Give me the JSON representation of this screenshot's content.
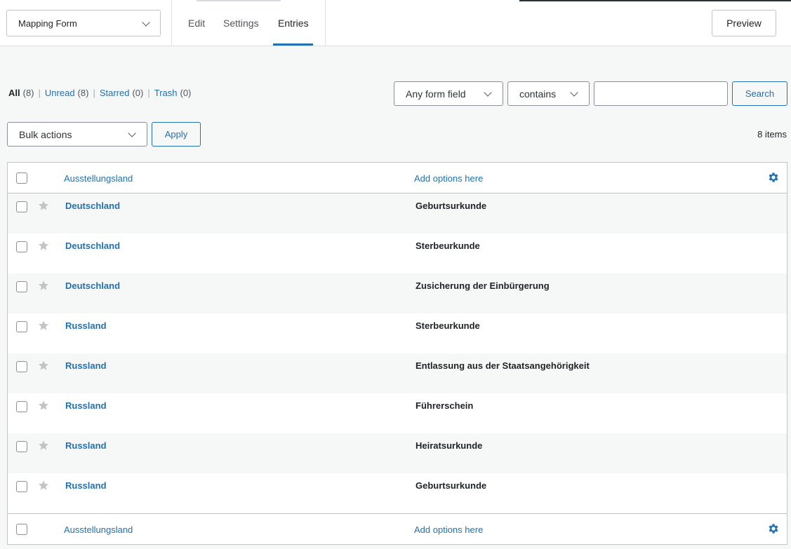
{
  "header": {
    "form_selector": "Mapping Form",
    "tabs": [
      {
        "label": "Edit"
      },
      {
        "label": "Settings"
      },
      {
        "label": "Entries"
      }
    ],
    "preview_label": "Preview"
  },
  "filters": {
    "views": [
      {
        "label": "All",
        "count": "(8)"
      },
      {
        "label": "Unread",
        "count": "(8)"
      },
      {
        "label": "Starred",
        "count": "(0)"
      },
      {
        "label": "Trash",
        "count": "(0)"
      }
    ],
    "field_select": "Any form field",
    "operator_select": "contains",
    "search_value": "",
    "search_label": "Search",
    "bulk_actions": "Bulk actions",
    "apply_label": "Apply",
    "items_count": "8 items"
  },
  "table": {
    "columns": [
      "Ausstellungsland",
      "Add options here"
    ],
    "rows": [
      {
        "country": "Deutschland",
        "document": "Geburtsurkunde"
      },
      {
        "country": "Deutschland",
        "document": "Sterbeurkunde"
      },
      {
        "country": "Deutschland",
        "document": "Zusicherung der Einbürgerung"
      },
      {
        "country": "Russland",
        "document": "Sterbeurkunde"
      },
      {
        "country": "Russland",
        "document": "Entlassung aus der Staatsangehörigkeit"
      },
      {
        "country": "Russland",
        "document": "Führerschein"
      },
      {
        "country": "Russland",
        "document": "Heiratsurkunde"
      },
      {
        "country": "Russland",
        "document": "Geburtsurkunde"
      }
    ]
  },
  "colors": {
    "accent": "#2271b1",
    "star": "#c3c4c7"
  }
}
